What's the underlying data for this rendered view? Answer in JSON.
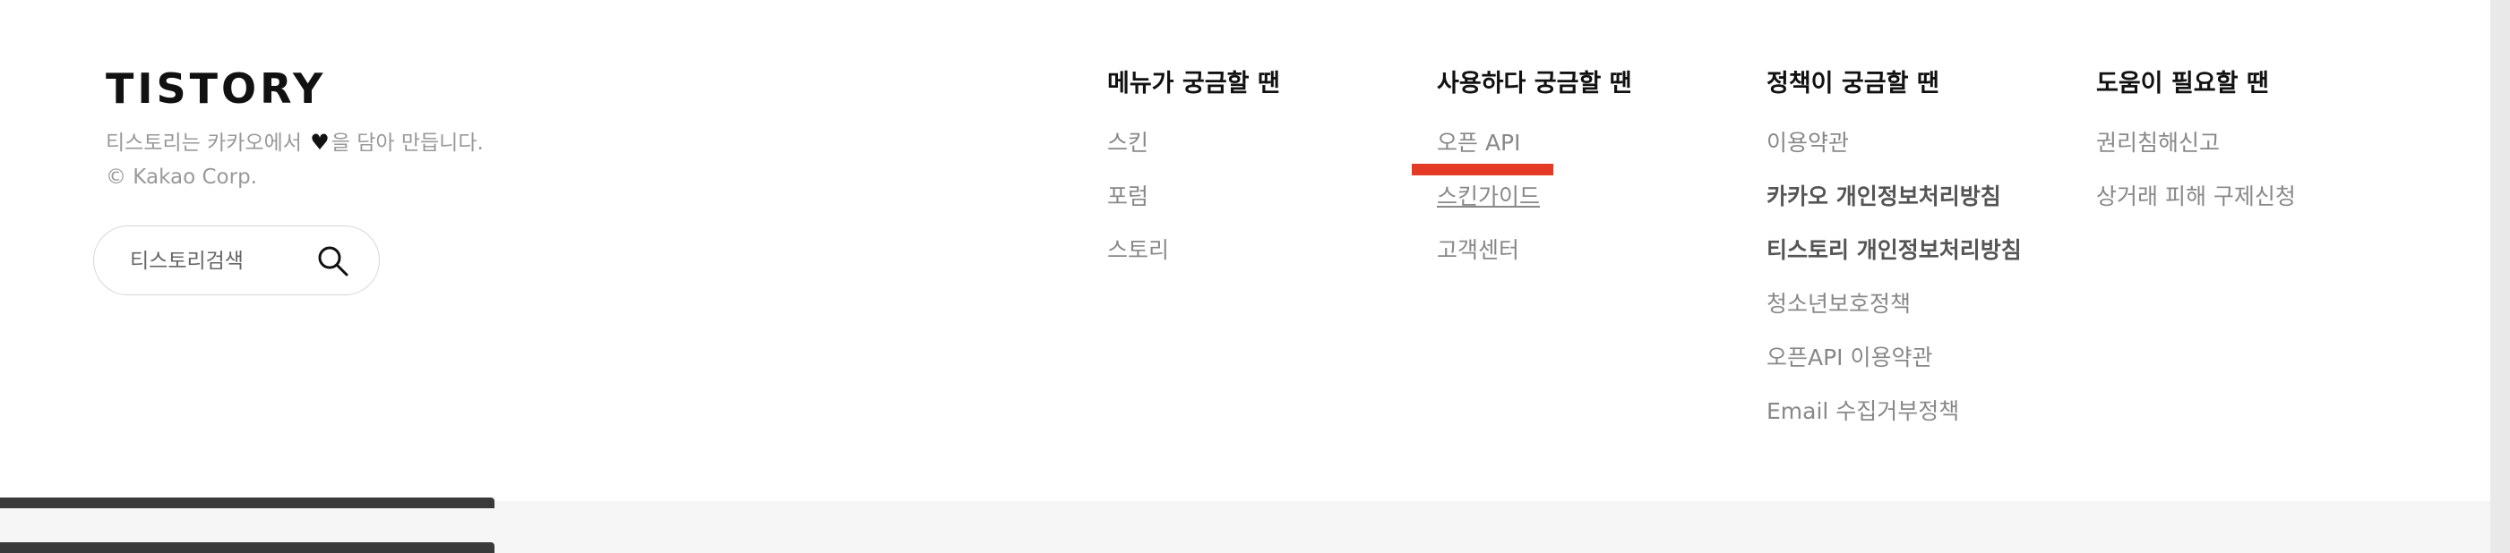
{
  "brand": {
    "logo_text": "TISTORY",
    "tagline_before": "티스토리는 카카오에서",
    "tagline_after": "을 담아 만듭니다.",
    "copyright": "© Kakao Corp."
  },
  "search": {
    "placeholder": "티스토리검색"
  },
  "columns": [
    {
      "title": "메뉴가 궁금할 땐",
      "items": [
        "스킨",
        "포럼",
        "스토리"
      ]
    },
    {
      "title": "사용하다 궁금할 땐",
      "items": [
        "오픈 API",
        "스킨가이드",
        "고객센터"
      ]
    },
    {
      "title": "정책이 궁금할 땐",
      "items": [
        "이용약관",
        "카카오 개인정보처리방침",
        "티스토리 개인정보처리방침",
        "청소년보호정책",
        "오픈API 이용약관",
        "Email 수집거부정책"
      ]
    },
    {
      "title": "도움이 필요할 땐",
      "items": [
        "권리침해신고",
        "상거래 피해 구제신청"
      ]
    }
  ],
  "colors": {
    "highlight": "#e33b25",
    "text_muted": "#888888",
    "text_strong": "#111111"
  },
  "icons": {
    "search": "search-icon",
    "heart": "heart-icon"
  }
}
